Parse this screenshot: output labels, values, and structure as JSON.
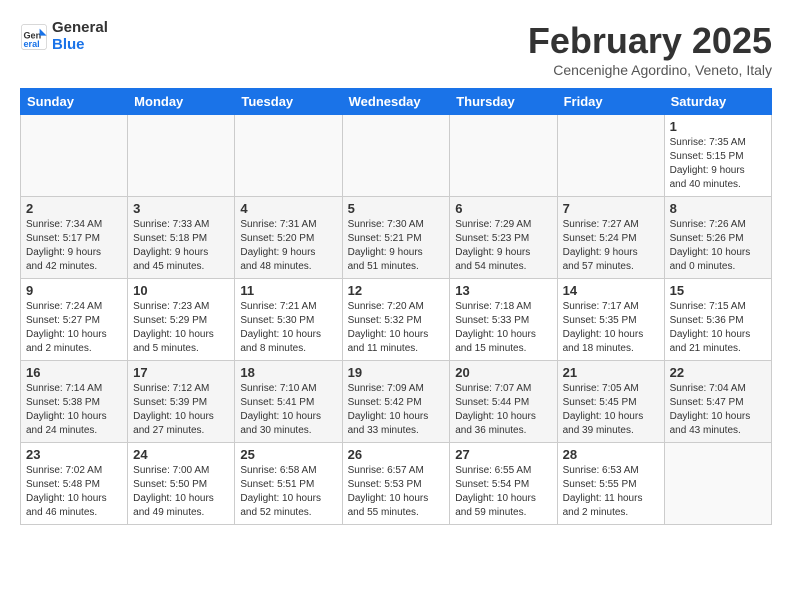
{
  "header": {
    "logo": {
      "line1": "General",
      "line2": "Blue"
    },
    "title": "February 2025",
    "location": "Cencenighe Agordino, Veneto, Italy"
  },
  "days_of_week": [
    "Sunday",
    "Monday",
    "Tuesday",
    "Wednesday",
    "Thursday",
    "Friday",
    "Saturday"
  ],
  "weeks": [
    {
      "days": [
        {
          "num": "",
          "info": ""
        },
        {
          "num": "",
          "info": ""
        },
        {
          "num": "",
          "info": ""
        },
        {
          "num": "",
          "info": ""
        },
        {
          "num": "",
          "info": ""
        },
        {
          "num": "",
          "info": ""
        },
        {
          "num": "1",
          "info": "Sunrise: 7:35 AM\nSunset: 5:15 PM\nDaylight: 9 hours\nand 40 minutes."
        }
      ]
    },
    {
      "days": [
        {
          "num": "2",
          "info": "Sunrise: 7:34 AM\nSunset: 5:17 PM\nDaylight: 9 hours\nand 42 minutes."
        },
        {
          "num": "3",
          "info": "Sunrise: 7:33 AM\nSunset: 5:18 PM\nDaylight: 9 hours\nand 45 minutes."
        },
        {
          "num": "4",
          "info": "Sunrise: 7:31 AM\nSunset: 5:20 PM\nDaylight: 9 hours\nand 48 minutes."
        },
        {
          "num": "5",
          "info": "Sunrise: 7:30 AM\nSunset: 5:21 PM\nDaylight: 9 hours\nand 51 minutes."
        },
        {
          "num": "6",
          "info": "Sunrise: 7:29 AM\nSunset: 5:23 PM\nDaylight: 9 hours\nand 54 minutes."
        },
        {
          "num": "7",
          "info": "Sunrise: 7:27 AM\nSunset: 5:24 PM\nDaylight: 9 hours\nand 57 minutes."
        },
        {
          "num": "8",
          "info": "Sunrise: 7:26 AM\nSunset: 5:26 PM\nDaylight: 10 hours\nand 0 minutes."
        }
      ]
    },
    {
      "days": [
        {
          "num": "9",
          "info": "Sunrise: 7:24 AM\nSunset: 5:27 PM\nDaylight: 10 hours\nand 2 minutes."
        },
        {
          "num": "10",
          "info": "Sunrise: 7:23 AM\nSunset: 5:29 PM\nDaylight: 10 hours\nand 5 minutes."
        },
        {
          "num": "11",
          "info": "Sunrise: 7:21 AM\nSunset: 5:30 PM\nDaylight: 10 hours\nand 8 minutes."
        },
        {
          "num": "12",
          "info": "Sunrise: 7:20 AM\nSunset: 5:32 PM\nDaylight: 10 hours\nand 11 minutes."
        },
        {
          "num": "13",
          "info": "Sunrise: 7:18 AM\nSunset: 5:33 PM\nDaylight: 10 hours\nand 15 minutes."
        },
        {
          "num": "14",
          "info": "Sunrise: 7:17 AM\nSunset: 5:35 PM\nDaylight: 10 hours\nand 18 minutes."
        },
        {
          "num": "15",
          "info": "Sunrise: 7:15 AM\nSunset: 5:36 PM\nDaylight: 10 hours\nand 21 minutes."
        }
      ]
    },
    {
      "days": [
        {
          "num": "16",
          "info": "Sunrise: 7:14 AM\nSunset: 5:38 PM\nDaylight: 10 hours\nand 24 minutes."
        },
        {
          "num": "17",
          "info": "Sunrise: 7:12 AM\nSunset: 5:39 PM\nDaylight: 10 hours\nand 27 minutes."
        },
        {
          "num": "18",
          "info": "Sunrise: 7:10 AM\nSunset: 5:41 PM\nDaylight: 10 hours\nand 30 minutes."
        },
        {
          "num": "19",
          "info": "Sunrise: 7:09 AM\nSunset: 5:42 PM\nDaylight: 10 hours\nand 33 minutes."
        },
        {
          "num": "20",
          "info": "Sunrise: 7:07 AM\nSunset: 5:44 PM\nDaylight: 10 hours\nand 36 minutes."
        },
        {
          "num": "21",
          "info": "Sunrise: 7:05 AM\nSunset: 5:45 PM\nDaylight: 10 hours\nand 39 minutes."
        },
        {
          "num": "22",
          "info": "Sunrise: 7:04 AM\nSunset: 5:47 PM\nDaylight: 10 hours\nand 43 minutes."
        }
      ]
    },
    {
      "days": [
        {
          "num": "23",
          "info": "Sunrise: 7:02 AM\nSunset: 5:48 PM\nDaylight: 10 hours\nand 46 minutes."
        },
        {
          "num": "24",
          "info": "Sunrise: 7:00 AM\nSunset: 5:50 PM\nDaylight: 10 hours\nand 49 minutes."
        },
        {
          "num": "25",
          "info": "Sunrise: 6:58 AM\nSunset: 5:51 PM\nDaylight: 10 hours\nand 52 minutes."
        },
        {
          "num": "26",
          "info": "Sunrise: 6:57 AM\nSunset: 5:53 PM\nDaylight: 10 hours\nand 55 minutes."
        },
        {
          "num": "27",
          "info": "Sunrise: 6:55 AM\nSunset: 5:54 PM\nDaylight: 10 hours\nand 59 minutes."
        },
        {
          "num": "28",
          "info": "Sunrise: 6:53 AM\nSunset: 5:55 PM\nDaylight: 11 hours\nand 2 minutes."
        },
        {
          "num": "",
          "info": ""
        }
      ]
    }
  ]
}
